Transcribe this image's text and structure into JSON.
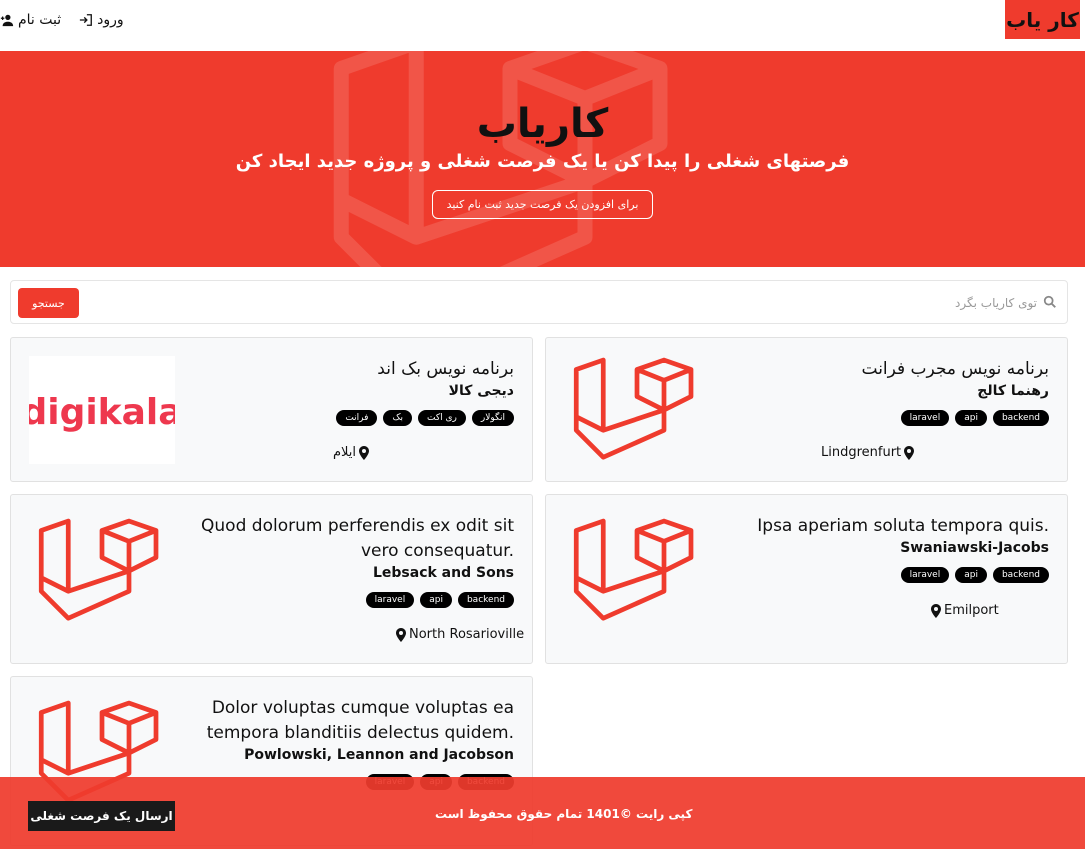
{
  "navbar": {
    "brand": "کار یاب",
    "login": "ورود",
    "register": "ثبت نام"
  },
  "hero": {
    "title": "کاریاب",
    "subtitle": "فرصتهای شغلی را پیدا کن یا یک فرصت شغلی و پروژه جدید ایجاد کن",
    "button": "برای افزودن یک فرصت جدید ثبت نام کنید"
  },
  "search": {
    "placeholder": "توی کاریاب بگرد",
    "button": "جستجو"
  },
  "jobs": [
    {
      "title": "برنامه نویس مجرب فرانت",
      "company": "رهنما کالج",
      "tags": [
        "laravel",
        "api",
        "backend"
      ],
      "location": "Lindgrenfurt",
      "logo": "laravel-logo"
    },
    {
      "title": "برنامه نویس بک اند",
      "company": "دیجی کالا",
      "tags": [
        "فرانت",
        "بک",
        "ری اکت",
        "انگولار"
      ],
      "location": "ایلام",
      "logo": "digikala-logo",
      "logo_text": "digikala"
    },
    {
      "title": "Ipsa aperiam soluta tempora quis.",
      "company": "Swaniawski-Jacobs",
      "tags": [
        "laravel",
        "api",
        "backend"
      ],
      "location": "Emilport",
      "logo": "laravel-logo"
    },
    {
      "title_line1": "Quod dolorum perferendis ex odit sit",
      "title_line2": "vero consequatur.",
      "company": "Lebsack and Sons",
      "tags": [
        "laravel",
        "api",
        "backend"
      ],
      "location": "North Rosarioville",
      "logo": "laravel-logo"
    },
    {
      "title_line1": "Dolor voluptas cumque voluptas ea",
      "title_line2": "tempora blanditiis delectus quidem.",
      "company": "Powlowski, Leannon and Jacobson",
      "tags": [
        "laravel",
        "api",
        "backend"
      ],
      "logo": "laravel-logo"
    }
  ],
  "footer": {
    "copyright": "کپی رایت ©1401 تمام حقوق محفوظ است",
    "button": "ارسال یک فرصت شغلی"
  },
  "colors": {
    "brand_red": "#ef3b2d",
    "laravel_red": "#ef3b2d",
    "digikala_red": "#ee384e",
    "tag_bg": "#000000",
    "footer_button": "#1a1a1a"
  }
}
